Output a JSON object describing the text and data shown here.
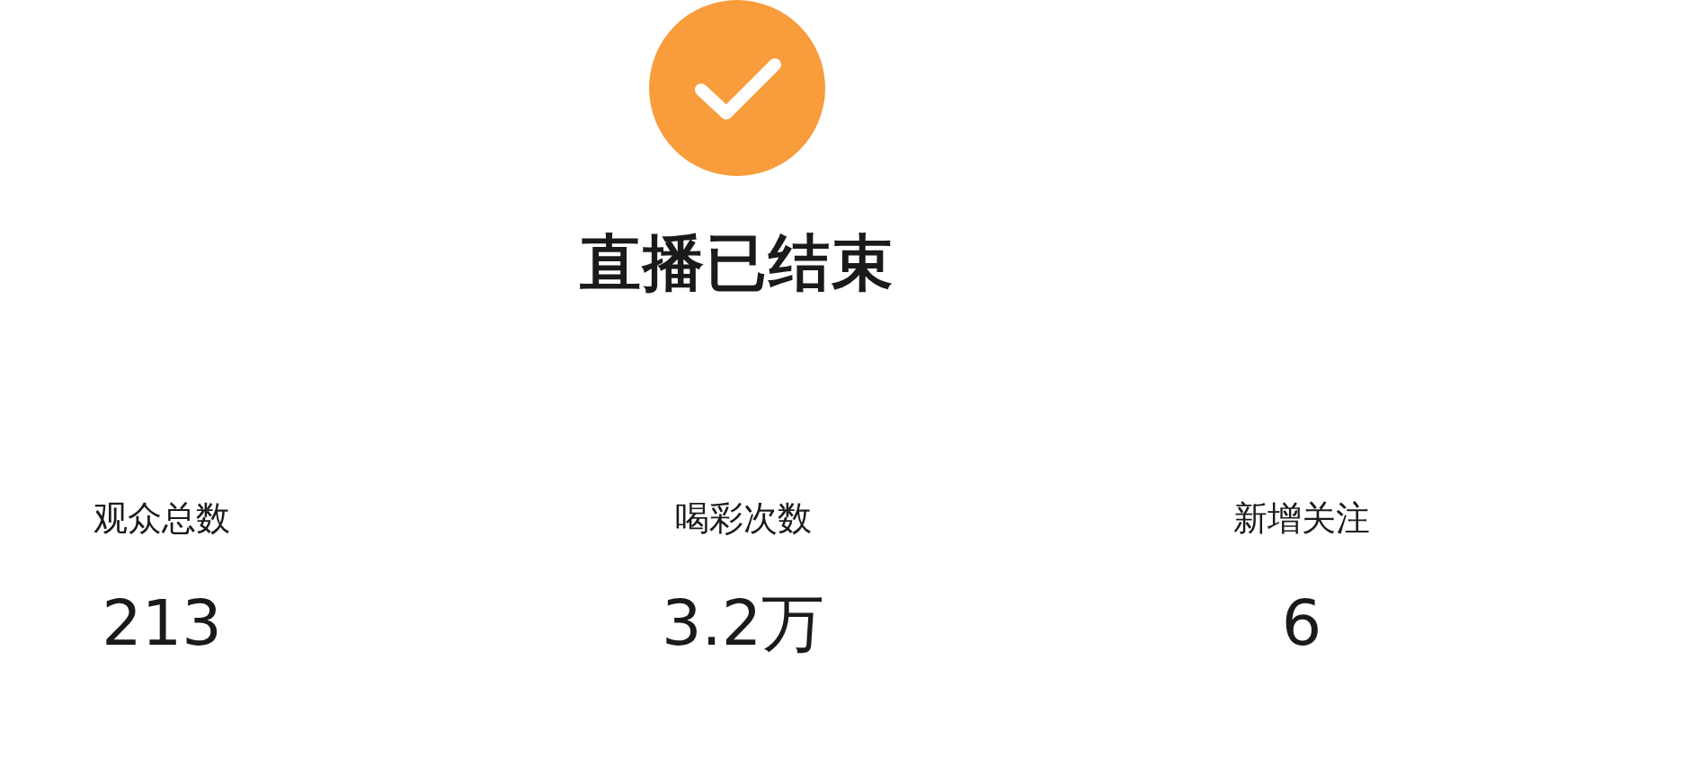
{
  "status": {
    "title": "直播已结束"
  },
  "stats": [
    {
      "label": "观众总数",
      "value": "213"
    },
    {
      "label": "喝彩次数",
      "value": "3.2万"
    },
    {
      "label": "新增关注",
      "value": "6"
    }
  ]
}
